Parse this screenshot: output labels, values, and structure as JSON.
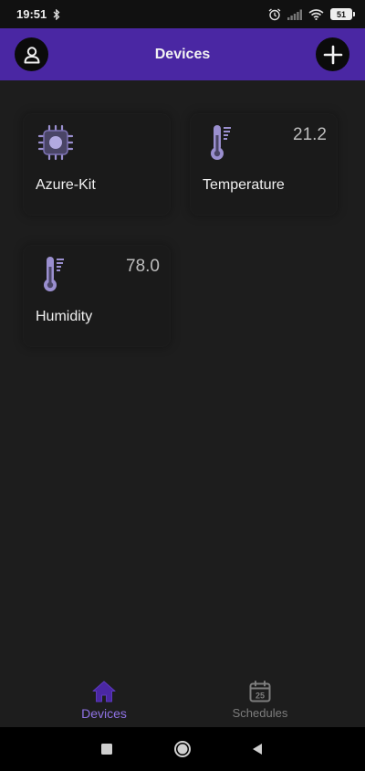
{
  "status_bar": {
    "time": "19:51",
    "battery": "51"
  },
  "app_bar": {
    "title": "Devices"
  },
  "devices": [
    {
      "name": "Azure-Kit",
      "value": "",
      "icon": "chip-icon"
    },
    {
      "name": "Temperature",
      "value": "21.2",
      "icon": "thermometer-icon"
    },
    {
      "name": "Humidity",
      "value": "78.0",
      "icon": "thermometer-icon"
    }
  ],
  "bottom_nav": {
    "devices_label": "Devices",
    "schedules_label": "Schedules",
    "calendar_day": "25",
    "active": "Devices"
  },
  "colors": {
    "accent": "#4a27a3",
    "active_nav": "#8f72e4",
    "icon": "#9a8fcf"
  }
}
